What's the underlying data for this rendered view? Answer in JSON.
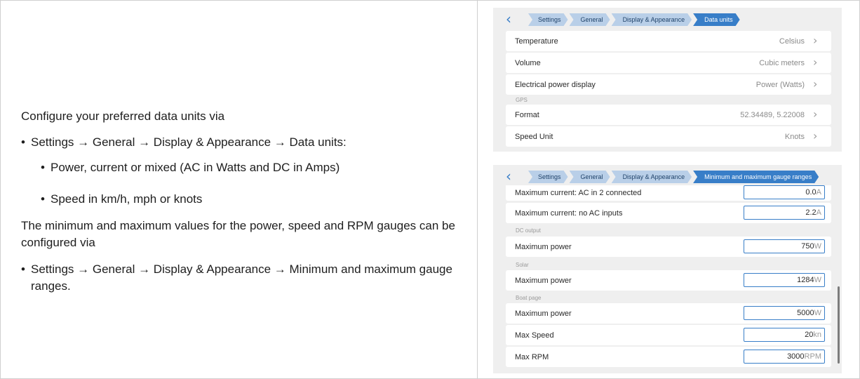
{
  "doc": {
    "intro": "Configure your preferred data units via",
    "path1": "Settings → General → Display & Appearance → Data units:",
    "sub_items": [
      "Power, current or mixed (AC in Watts and DC in Amps)",
      "Speed in km/h, mph or knots"
    ],
    "para2": "The minimum and maximum values for the power, speed and RPM gauges can be configured via",
    "path2": "Settings → General → Display & Appearance → Minimum and maximum gauge ranges."
  },
  "screen1": {
    "back_icon": "chevron-left-icon",
    "breadcrumbs": [
      "Settings",
      "General",
      "Display & Appearance",
      "Data units"
    ],
    "rows": [
      {
        "label": "Temperature",
        "value": "Celsius"
      },
      {
        "label": "Volume",
        "value": "Cubic meters"
      },
      {
        "label": "Electrical power display",
        "value": "Power (Watts)"
      }
    ],
    "gps_section": "GPS",
    "gps_rows": [
      {
        "label": "Format",
        "value": "52.34489, 5.22008"
      },
      {
        "label": "Speed Unit",
        "value": "Knots"
      }
    ]
  },
  "screen2": {
    "breadcrumbs": [
      "Settings",
      "General",
      "Display & Appearance",
      "Minimum and maximum gauge ranges"
    ],
    "rows_top": [
      {
        "label": "Maximum current: AC in 2 connected",
        "value": "0.0",
        "unit": "A"
      },
      {
        "label": "Maximum current: no AC inputs",
        "value": "2.2",
        "unit": "A"
      }
    ],
    "dc_section": "DC output",
    "dc_row": {
      "label": "Maximum power",
      "value": "750",
      "unit": "W"
    },
    "solar_section": "Solar",
    "solar_row": {
      "label": "Maximum power",
      "value": "1284",
      "unit": "W"
    },
    "boat_section": "Boat page",
    "boat_rows": [
      {
        "label": "Maximum power",
        "value": "5000",
        "unit": "W"
      },
      {
        "label": "Max Speed",
        "value": "20",
        "unit": "kn"
      },
      {
        "label": "Max RPM",
        "value": "3000",
        "unit": "RPM"
      }
    ]
  },
  "colors": {
    "accent": "#387ec8",
    "crumb": "#b9cfe8",
    "screen_bg": "#efefef"
  }
}
